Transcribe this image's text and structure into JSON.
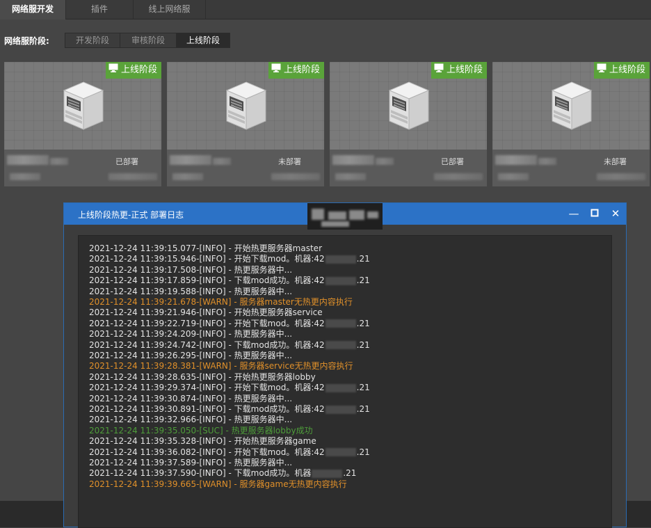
{
  "tabs": [
    {
      "label": "网络服开发",
      "active": true
    },
    {
      "label": "插件",
      "active": false
    },
    {
      "label": "线上网络服",
      "active": false
    }
  ],
  "stage": {
    "label": "网络服阶段:",
    "options": [
      {
        "label": "开发阶段",
        "active": false
      },
      {
        "label": "审核阶段",
        "active": false
      },
      {
        "label": "上线阶段",
        "active": true
      }
    ]
  },
  "cards": [
    {
      "badge": "上线阶段",
      "status": "已部署",
      "icon": "server-icon"
    },
    {
      "badge": "上线阶段",
      "status": "未部署",
      "icon": "server-icon"
    },
    {
      "badge": "上线阶段",
      "status": "已部署",
      "icon": "server-icon"
    },
    {
      "badge": "上线阶段",
      "status": "未部署",
      "icon": "server-icon"
    }
  ],
  "dialog": {
    "title": "上线阶段热更-正式 部署日志",
    "controls": [
      "—",
      "☐",
      "✕"
    ],
    "logs": [
      {
        "level": "info",
        "text": "2021-12-24 11:39:15.077-[INFO] - 开始热更服务器master",
        "ip": false
      },
      {
        "level": "info",
        "text": "2021-12-24 11:39:15.946-[INFO] - 开始下载mod。机器:42",
        "ip": true,
        "suffix": ".21"
      },
      {
        "level": "info",
        "text": "2021-12-24 11:39:17.508-[INFO] - 热更服务器中...",
        "ip": false
      },
      {
        "level": "info",
        "text": "2021-12-24 11:39:17.859-[INFO] - 下载mod成功。机器:42",
        "ip": true,
        "suffix": ".21"
      },
      {
        "level": "info",
        "text": "2021-12-24 11:39:19.588-[INFO] - 热更服务器中...",
        "ip": false
      },
      {
        "level": "warn",
        "text": "2021-12-24 11:39:21.678-[WARN] - 服务器master无热更内容执行",
        "ip": false
      },
      {
        "level": "info",
        "text": "2021-12-24 11:39:21.946-[INFO] - 开始热更服务器service",
        "ip": false
      },
      {
        "level": "info",
        "text": "2021-12-24 11:39:22.719-[INFO] - 开始下载mod。机器:42",
        "ip": true,
        "suffix": ".21"
      },
      {
        "level": "info",
        "text": "2021-12-24 11:39:24.209-[INFO] - 热更服务器中...",
        "ip": false
      },
      {
        "level": "info",
        "text": "2021-12-24 11:39:24.742-[INFO] - 下载mod成功。机器:42",
        "ip": true,
        "suffix": ".21"
      },
      {
        "level": "info",
        "text": "2021-12-24 11:39:26.295-[INFO] - 热更服务器中...",
        "ip": false
      },
      {
        "level": "warn",
        "text": "2021-12-24 11:39:28.381-[WARN] - 服务器service无热更内容执行",
        "ip": false
      },
      {
        "level": "info",
        "text": "2021-12-24 11:39:28.635-[INFO] - 开始热更服务器lobby",
        "ip": false
      },
      {
        "level": "info",
        "text": "2021-12-24 11:39:29.374-[INFO] - 开始下载mod。机器:42",
        "ip": true,
        "suffix": ".21"
      },
      {
        "level": "info",
        "text": "2021-12-24 11:39:30.874-[INFO] - 热更服务器中...",
        "ip": false
      },
      {
        "level": "info",
        "text": "2021-12-24 11:39:30.891-[INFO] - 下载mod成功。机器:42",
        "ip": true,
        "suffix": ".21"
      },
      {
        "level": "info",
        "text": "2021-12-24 11:39:32.966-[INFO] - 热更服务器中...",
        "ip": false
      },
      {
        "level": "suc",
        "text": "2021-12-24 11:39:35.050-[SUC] - 热更服务器lobby成功",
        "ip": false
      },
      {
        "level": "info",
        "text": "2021-12-24 11:39:35.328-[INFO] - 开始热更服务器game",
        "ip": false
      },
      {
        "level": "info",
        "text": "2021-12-24 11:39:36.082-[INFO] - 开始下载mod。机器:42",
        "ip": true,
        "suffix": ".21"
      },
      {
        "level": "info",
        "text": "2021-12-24 11:39:37.589-[INFO] - 热更服务器中...",
        "ip": false
      },
      {
        "level": "info",
        "text": "2021-12-24 11:39:37.590-[INFO] - 下载mod成功。机器",
        "ip": true,
        "suffix": ".21"
      },
      {
        "level": "warn",
        "text": "2021-12-24 11:39:39.665-[WARN] - 服务器game无热更内容执行",
        "ip": false
      }
    ]
  },
  "colors": {
    "accent_blue": "#2c72c6",
    "badge_green": "#5aa33a",
    "warn": "#e0902a",
    "success": "#4e9d3a"
  }
}
